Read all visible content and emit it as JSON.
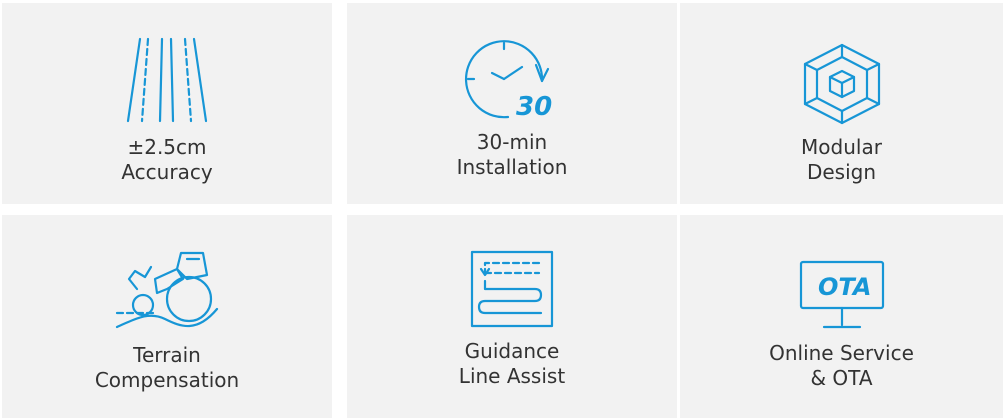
{
  "colors": {
    "accent": "#1796d6",
    "card_bg": "#f2f2f2",
    "text": "#333333"
  },
  "features": [
    {
      "icon": "lane-lines-icon",
      "lines": [
        "±2.5cm",
        "Accuracy"
      ]
    },
    {
      "icon": "timer-30-icon",
      "icon_text": "30",
      "lines": [
        "30-min",
        "Installation"
      ]
    },
    {
      "icon": "modular-cube-icon",
      "lines": [
        "Modular",
        "Design"
      ]
    },
    {
      "icon": "tractor-slope-icon",
      "lines": [
        "Terrain",
        "Compensation"
      ]
    },
    {
      "icon": "guidance-path-icon",
      "lines": [
        "Guidance",
        "Line Assist"
      ]
    },
    {
      "icon": "ota-monitor-icon",
      "icon_text": "OTA",
      "lines": [
        "Online Service",
        "& OTA"
      ]
    }
  ]
}
